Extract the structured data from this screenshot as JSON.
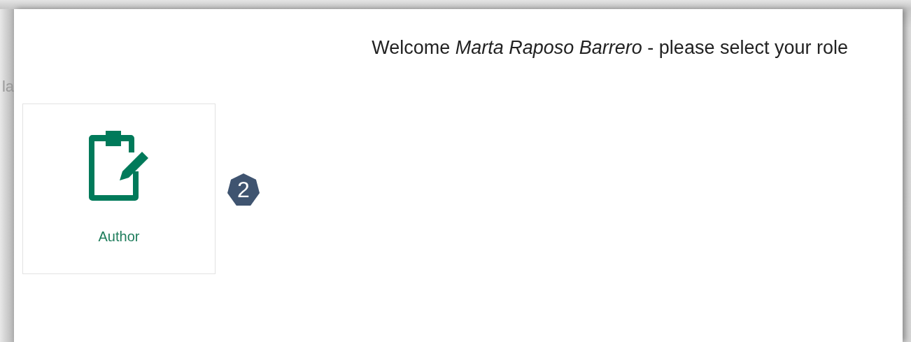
{
  "background": {
    "text": "la"
  },
  "dialog": {
    "heading": "Welcome *Marta Raposo Barrero* - please select your role",
    "roles": [
      {
        "label": "Author",
        "kind": "clipboard"
      }
    ],
    "step_badge": "2"
  }
}
